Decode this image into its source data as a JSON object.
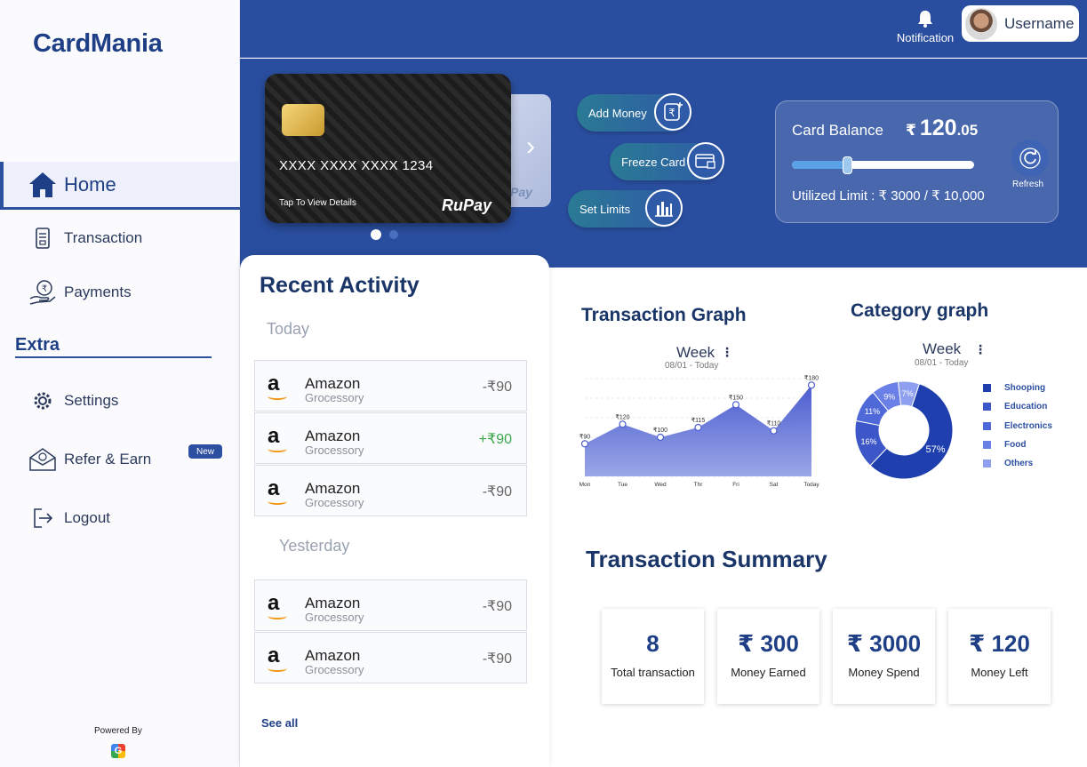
{
  "app": {
    "logo": "CardMania"
  },
  "sidebar": {
    "items": [
      {
        "label": "Home"
      },
      {
        "label": "Transaction"
      },
      {
        "label": "Payments"
      }
    ],
    "extra_title": "Extra",
    "extra_items": [
      {
        "label": "Settings"
      },
      {
        "label": "Refer & Earn",
        "badge": "New"
      },
      {
        "label": "Logout"
      }
    ],
    "powered_by": "Powered By",
    "powered_logo": "G"
  },
  "header": {
    "notification_label": "Notification",
    "username": "Username"
  },
  "card": {
    "number": "XXXX XXXX XXXX 1234",
    "tap_text": "Tap To View Details",
    "brand": "RuPay",
    "back_brand": "Pay",
    "arrow": "›"
  },
  "actions": {
    "add_money": "Add Money",
    "freeze_card": "Freeze Card",
    "set_limits": "Set Limits"
  },
  "balance": {
    "label": "Card Balance",
    "currency": "₹",
    "amount_main": "120",
    "amount_decimal": ".05",
    "utilized": "Utilized Limit : ₹ 3000 / ₹ 10,000",
    "utilized_fraction": 0.3,
    "refresh": "Refresh"
  },
  "recent": {
    "title": "Recent Activity",
    "today_label": "Today",
    "yesterday_label": "Yesterday",
    "today": [
      {
        "name": "Amazon",
        "category": "Grocessory",
        "amount": "-₹90"
      },
      {
        "name": "Amazon",
        "category": "Grocessory",
        "amount": "+₹90"
      },
      {
        "name": "Amazon",
        "category": "Grocessory",
        "amount": "-₹90"
      }
    ],
    "yesterday": [
      {
        "name": "Amazon",
        "category": "Grocessory",
        "amount": "-₹90"
      },
      {
        "name": "Amazon",
        "category": "Grocessory",
        "amount": "-₹90"
      }
    ],
    "see_all": "See all",
    "logo_letter": "a"
  },
  "transaction_graph": {
    "title": "Transaction Graph",
    "period": "Week",
    "range": "08/01 - Today",
    "menu": "⋮"
  },
  "category_graph": {
    "title": "Category graph",
    "period": "Week",
    "range": "08/01 - Today",
    "menu": "⋮"
  },
  "chart_data": [
    {
      "type": "area",
      "x": [
        "Mon",
        "Tue",
        "Wed",
        "Thr",
        "Fri",
        "Sat",
        "Today"
      ],
      "values": [
        90,
        120,
        100,
        115,
        150,
        110,
        180
      ],
      "labels": [
        "₹90",
        "₹120",
        "₹100",
        "₹115",
        "₹150",
        "₹110",
        "₹180"
      ],
      "ylim": [
        40,
        190
      ],
      "grid": true,
      "color": "#4a5bc4"
    },
    {
      "type": "pie",
      "donut": true,
      "categories": [
        "Shooping",
        "Education",
        "Electronics",
        "Food",
        "Others"
      ],
      "values": [
        57,
        16,
        11,
        9,
        7
      ],
      "labels": [
        "57%",
        "16%",
        "11%",
        "9%",
        "7%"
      ],
      "colors": [
        "#1f3fae",
        "#3d57c9",
        "#5069d8",
        "#6b80e6",
        "#8e9ff0"
      ],
      "legend": "right"
    }
  ],
  "summary": {
    "title": "Transaction Summary",
    "cards": [
      {
        "value": "8",
        "label": "Total transaction"
      },
      {
        "value": "₹ 300",
        "label": "Money Earned"
      },
      {
        "value": "₹ 3000",
        "label": "Money Spend"
      },
      {
        "value": "₹ 120",
        "label": "Money Left"
      }
    ]
  },
  "colors": {
    "primary": "#2a4e9f",
    "accent": "#1e3f85",
    "positive": "#3aa64a"
  },
  "icons": [
    "home-icon",
    "transaction-icon",
    "payments-icon",
    "settings-icon",
    "refer-icon",
    "logout-icon",
    "bell-icon",
    "rupee-icon",
    "freeze-icon",
    "limits-icon",
    "refresh-icon"
  ]
}
